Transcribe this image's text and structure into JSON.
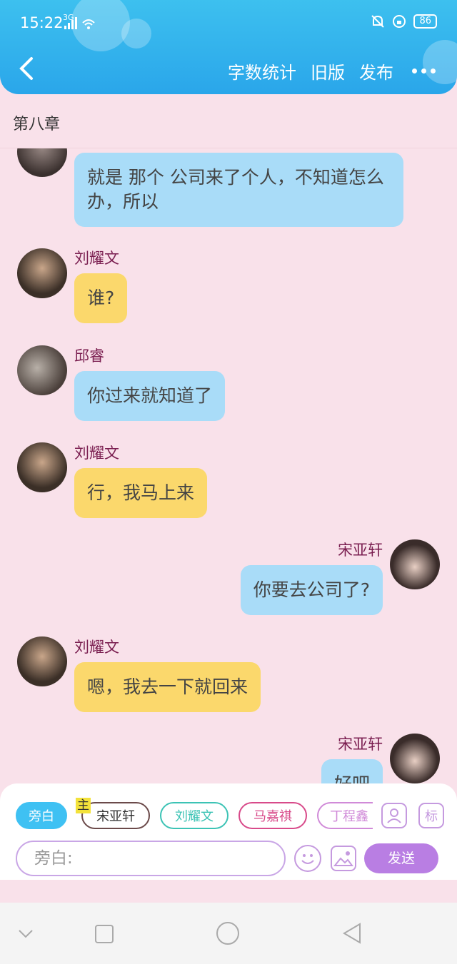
{
  "status_bar": {
    "time": "15:22",
    "network": "3G",
    "battery": "86"
  },
  "nav": {
    "actions": [
      "字数统计",
      "旧版",
      "发布"
    ]
  },
  "chapter_title": "第八章",
  "messages": [
    {
      "side": "left",
      "speaker": "",
      "text": "就是 那个 公司来了个人，不知道怎么办，所以",
      "color": "blue"
    },
    {
      "side": "left",
      "speaker": "刘耀文",
      "text": "谁?",
      "color": "yellow"
    },
    {
      "side": "left",
      "speaker": "邱睿",
      "text": "你过来就知道了",
      "color": "blue"
    },
    {
      "side": "left",
      "speaker": "刘耀文",
      "text": "行，我马上来",
      "color": "yellow"
    },
    {
      "side": "right",
      "speaker": "宋亚轩",
      "text": "你要去公司了?",
      "color": "blue"
    },
    {
      "side": "left",
      "speaker": "刘耀文",
      "text": "嗯，我去一下就回来",
      "color": "yellow"
    },
    {
      "side": "right",
      "speaker": "宋亚轩",
      "text": "好吧",
      "color": "blue"
    }
  ],
  "panel": {
    "tags": [
      "旁白",
      "宋亚轩",
      "刘耀文",
      "马嘉祺",
      "丁程鑫"
    ],
    "main_badge": "主",
    "biao_label": "标",
    "input_placeholder": "旁白:",
    "send_label": "发送"
  },
  "colors": {
    "header": "#2aa6ea",
    "background": "#f9e1ea",
    "bubble_blue": "#a9dcf8",
    "bubble_yellow": "#fbd86c",
    "send": "#b97ee3"
  }
}
